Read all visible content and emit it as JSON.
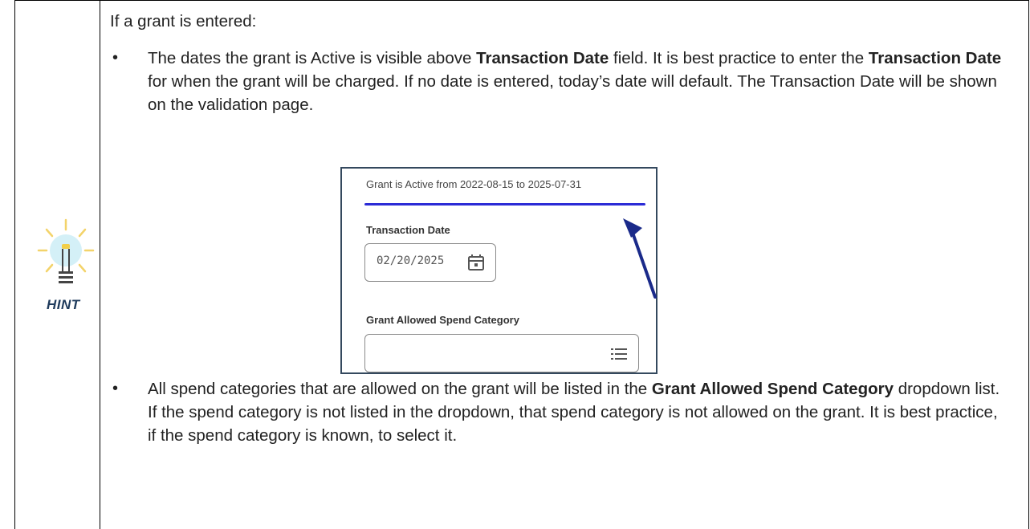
{
  "hint": {
    "label": "HINT",
    "icon": "lightbulb-icon"
  },
  "intro": "If a grant is entered:",
  "bullets": [
    {
      "dot": "•",
      "parts": [
        {
          "text": "The dates the grant is Active is visible above ",
          "bold": false
        },
        {
          "text": "Transaction Date",
          "bold": true
        },
        {
          "text": " field.  It is best practice to enter the ",
          "bold": false
        },
        {
          "text": "Transaction Date",
          "bold": true
        },
        {
          "text": " for when the grant will be charged.  If no date is entered, today’s date will default. The Transaction Date will be shown on the validation page.",
          "bold": false
        }
      ]
    },
    {
      "dot": "•",
      "parts": [
        {
          "text": "All spend categories that are allowed on the grant will be listed in the ",
          "bold": false
        },
        {
          "text": "Grant Allowed Spend Category",
          "bold": true
        },
        {
          "text": " dropdown list.  If the spend category is not listed in the dropdown, that spend category is not allowed on the grant. It is best practice, if the spend category is known, to select it.",
          "bold": false
        }
      ]
    }
  ],
  "screenshot": {
    "active_text": "Grant is Active from 2022-08-15 to 2025-07-31",
    "transaction_date_label": "Transaction Date",
    "transaction_date_value": "02/20/2025",
    "spend_category_label": "Grant Allowed Spend Category",
    "spend_category_value": "",
    "calendar_icon": "calendar-icon",
    "list_icon": "list-icon",
    "underline_color": "#2b2bd6",
    "arrow_color": "#1a2a8a"
  }
}
